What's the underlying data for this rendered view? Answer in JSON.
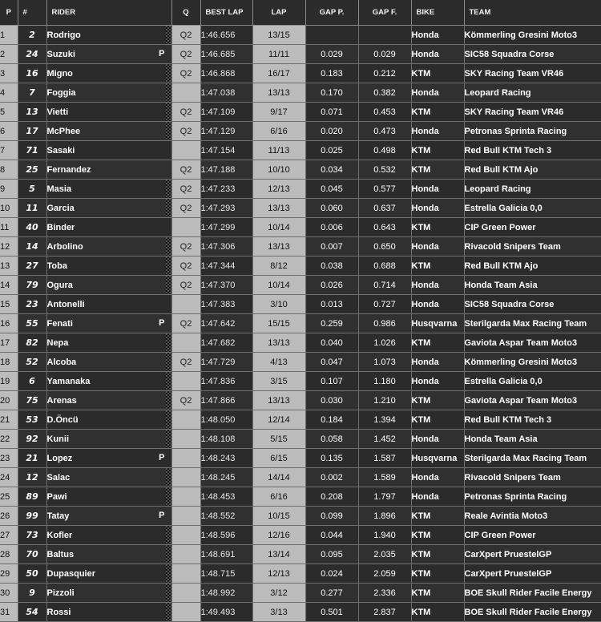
{
  "headers": {
    "pos": "P",
    "num": "#",
    "rider": "RIDER",
    "q": "Q",
    "best_lap": "BEST LAP",
    "lap": "LAP",
    "gap_p": "GAP P.",
    "gap_f": "GAP F.",
    "bike": "BIKE",
    "team": "TEAM"
  },
  "rows": [
    {
      "pos": "1",
      "num": "2",
      "rider": "Rodrigo",
      "mark": "",
      "flag": true,
      "q": "Q2",
      "best": "1:46.656",
      "lap": "13/15",
      "gap_p": "",
      "gap_f": "",
      "bike": "Honda",
      "team": "Kömmerling Gresini Moto3"
    },
    {
      "pos": "2",
      "num": "24",
      "rider": "Suzuki",
      "mark": "P",
      "flag": false,
      "q": "Q2",
      "best": "1:46.685",
      "lap": "11/11",
      "gap_p": "0.029",
      "gap_f": "0.029",
      "bike": "Honda",
      "team": "SIC58 Squadra Corse"
    },
    {
      "pos": "3",
      "num": "16",
      "rider": "Migno",
      "mark": "",
      "flag": true,
      "q": "Q2",
      "best": "1:46.868",
      "lap": "16/17",
      "gap_p": "0.183",
      "gap_f": "0.212",
      "bike": "KTM",
      "team": "SKY Racing Team VR46"
    },
    {
      "pos": "4",
      "num": "7",
      "rider": "Foggia",
      "mark": "",
      "flag": true,
      "q": "",
      "best": "1:47.038",
      "lap": "13/13",
      "gap_p": "0.170",
      "gap_f": "0.382",
      "bike": "Honda",
      "team": "Leopard Racing"
    },
    {
      "pos": "5",
      "num": "13",
      "rider": "Vietti",
      "mark": "",
      "flag": true,
      "q": "Q2",
      "best": "1:47.109",
      "lap": "9/17",
      "gap_p": "0.071",
      "gap_f": "0.453",
      "bike": "KTM",
      "team": "SKY Racing Team VR46"
    },
    {
      "pos": "6",
      "num": "17",
      "rider": "McPhee",
      "mark": "",
      "flag": true,
      "q": "Q2",
      "best": "1:47.129",
      "lap": "6/16",
      "gap_p": "0.020",
      "gap_f": "0.473",
      "bike": "Honda",
      "team": "Petronas Sprinta Racing"
    },
    {
      "pos": "7",
      "num": "71",
      "rider": "Sasaki",
      "mark": "",
      "flag": false,
      "q": "",
      "best": "1:47.154",
      "lap": "11/13",
      "gap_p": "0.025",
      "gap_f": "0.498",
      "bike": "KTM",
      "team": "Red Bull KTM Tech 3"
    },
    {
      "pos": "8",
      "num": "25",
      "rider": "Fernandez",
      "mark": "",
      "flag": false,
      "q": "Q2",
      "best": "1:47.188",
      "lap": "10/10",
      "gap_p": "0.034",
      "gap_f": "0.532",
      "bike": "KTM",
      "team": "Red Bull KTM Ajo"
    },
    {
      "pos": "9",
      "num": "5",
      "rider": "Masia",
      "mark": "",
      "flag": true,
      "q": "Q2",
      "best": "1:47.233",
      "lap": "12/13",
      "gap_p": "0.045",
      "gap_f": "0.577",
      "bike": "Honda",
      "team": "Leopard Racing"
    },
    {
      "pos": "10",
      "num": "11",
      "rider": "Garcia",
      "mark": "",
      "flag": true,
      "q": "Q2",
      "best": "1:47.293",
      "lap": "13/13",
      "gap_p": "0.060",
      "gap_f": "0.637",
      "bike": "Honda",
      "team": "Estrella Galicia 0,0"
    },
    {
      "pos": "11",
      "num": "40",
      "rider": "Binder",
      "mark": "",
      "flag": false,
      "q": "",
      "best": "1:47.299",
      "lap": "10/14",
      "gap_p": "0.006",
      "gap_f": "0.643",
      "bike": "KTM",
      "team": "CIP Green Power"
    },
    {
      "pos": "12",
      "num": "14",
      "rider": "Arbolino",
      "mark": "",
      "flag": true,
      "q": "Q2",
      "best": "1:47.306",
      "lap": "13/13",
      "gap_p": "0.007",
      "gap_f": "0.650",
      "bike": "Honda",
      "team": "Rivacold Snipers Team"
    },
    {
      "pos": "13",
      "num": "27",
      "rider": "Toba",
      "mark": "",
      "flag": true,
      "q": "Q2",
      "best": "1:47.344",
      "lap": "8/12",
      "gap_p": "0.038",
      "gap_f": "0.688",
      "bike": "KTM",
      "team": "Red Bull KTM Ajo"
    },
    {
      "pos": "14",
      "num": "79",
      "rider": "Ogura",
      "mark": "",
      "flag": true,
      "q": "Q2",
      "best": "1:47.370",
      "lap": "10/14",
      "gap_p": "0.026",
      "gap_f": "0.714",
      "bike": "Honda",
      "team": "Honda Team Asia"
    },
    {
      "pos": "15",
      "num": "23",
      "rider": "Antonelli",
      "mark": "",
      "flag": false,
      "q": "",
      "best": "1:47.383",
      "lap": "3/10",
      "gap_p": "0.013",
      "gap_f": "0.727",
      "bike": "Honda",
      "team": "SIC58 Squadra Corse"
    },
    {
      "pos": "16",
      "num": "55",
      "rider": "Fenati",
      "mark": "P",
      "flag": false,
      "q": "Q2",
      "best": "1:47.642",
      "lap": "15/15",
      "gap_p": "0.259",
      "gap_f": "0.986",
      "bike": "Husqvarna",
      "team": "Sterilgarda Max Racing Team"
    },
    {
      "pos": "17",
      "num": "82",
      "rider": "Nepa",
      "mark": "",
      "flag": true,
      "q": "",
      "best": "1:47.682",
      "lap": "13/13",
      "gap_p": "0.040",
      "gap_f": "1.026",
      "bike": "KTM",
      "team": "Gaviota Aspar Team Moto3"
    },
    {
      "pos": "18",
      "num": "52",
      "rider": "Alcoba",
      "mark": "",
      "flag": true,
      "q": "Q2",
      "best": "1:47.729",
      "lap": "4/13",
      "gap_p": "0.047",
      "gap_f": "1.073",
      "bike": "Honda",
      "team": "Kömmerling Gresini Moto3"
    },
    {
      "pos": "19",
      "num": "6",
      "rider": "Yamanaka",
      "mark": "",
      "flag": true,
      "q": "",
      "best": "1:47.836",
      "lap": "3/15",
      "gap_p": "0.107",
      "gap_f": "1.180",
      "bike": "Honda",
      "team": "Estrella Galicia 0,0"
    },
    {
      "pos": "20",
      "num": "75",
      "rider": "Arenas",
      "mark": "",
      "flag": true,
      "q": "Q2",
      "best": "1:47.866",
      "lap": "13/13",
      "gap_p": "0.030",
      "gap_f": "1.210",
      "bike": "KTM",
      "team": "Gaviota Aspar Team Moto3"
    },
    {
      "pos": "21",
      "num": "53",
      "rider": "D.Öncü",
      "mark": "",
      "flag": true,
      "q": "",
      "best": "1:48.050",
      "lap": "12/14",
      "gap_p": "0.184",
      "gap_f": "1.394",
      "bike": "KTM",
      "team": "Red Bull KTM Tech 3"
    },
    {
      "pos": "22",
      "num": "92",
      "rider": "Kunii",
      "mark": "",
      "flag": true,
      "q": "",
      "best": "1:48.108",
      "lap": "5/15",
      "gap_p": "0.058",
      "gap_f": "1.452",
      "bike": "Honda",
      "team": "Honda Team Asia"
    },
    {
      "pos": "23",
      "num": "21",
      "rider": "Lopez",
      "mark": "P",
      "flag": false,
      "q": "",
      "best": "1:48.243",
      "lap": "6/15",
      "gap_p": "0.135",
      "gap_f": "1.587",
      "bike": "Husqvarna",
      "team": "Sterilgarda Max Racing Team"
    },
    {
      "pos": "24",
      "num": "12",
      "rider": "Salac",
      "mark": "",
      "flag": true,
      "q": "",
      "best": "1:48.245",
      "lap": "14/14",
      "gap_p": "0.002",
      "gap_f": "1.589",
      "bike": "Honda",
      "team": "Rivacold Snipers Team"
    },
    {
      "pos": "25",
      "num": "89",
      "rider": "Pawi",
      "mark": "",
      "flag": true,
      "q": "",
      "best": "1:48.453",
      "lap": "6/16",
      "gap_p": "0.208",
      "gap_f": "1.797",
      "bike": "Honda",
      "team": "Petronas Sprinta Racing"
    },
    {
      "pos": "26",
      "num": "99",
      "rider": "Tatay",
      "mark": "P",
      "flag": false,
      "q": "",
      "best": "1:48.552",
      "lap": "10/15",
      "gap_p": "0.099",
      "gap_f": "1.896",
      "bike": "KTM",
      "team": "Reale Avintia Moto3"
    },
    {
      "pos": "27",
      "num": "73",
      "rider": "Kofler",
      "mark": "",
      "flag": true,
      "q": "",
      "best": "1:48.596",
      "lap": "12/16",
      "gap_p": "0.044",
      "gap_f": "1.940",
      "bike": "KTM",
      "team": "CIP Green Power"
    },
    {
      "pos": "28",
      "num": "70",
      "rider": "Baltus",
      "mark": "",
      "flag": true,
      "q": "",
      "best": "1:48.691",
      "lap": "13/14",
      "gap_p": "0.095",
      "gap_f": "2.035",
      "bike": "KTM",
      "team": "CarXpert PruestelGP"
    },
    {
      "pos": "29",
      "num": "50",
      "rider": "Dupasquier",
      "mark": "",
      "flag": true,
      "q": "",
      "best": "1:48.715",
      "lap": "12/13",
      "gap_p": "0.024",
      "gap_f": "2.059",
      "bike": "KTM",
      "team": "CarXpert PruestelGP"
    },
    {
      "pos": "30",
      "num": "9",
      "rider": "Pizzoli",
      "mark": "",
      "flag": true,
      "q": "",
      "best": "1:48.992",
      "lap": "3/12",
      "gap_p": "0.277",
      "gap_f": "2.336",
      "bike": "KTM",
      "team": "BOE Skull Rider Facile Energy"
    },
    {
      "pos": "31",
      "num": "54",
      "rider": "Rossi",
      "mark": "",
      "flag": true,
      "q": "",
      "best": "1:49.493",
      "lap": "3/13",
      "gap_p": "0.501",
      "gap_f": "2.837",
      "bike": "KTM",
      "team": "BOE Skull Rider Facile Energy"
    }
  ]
}
